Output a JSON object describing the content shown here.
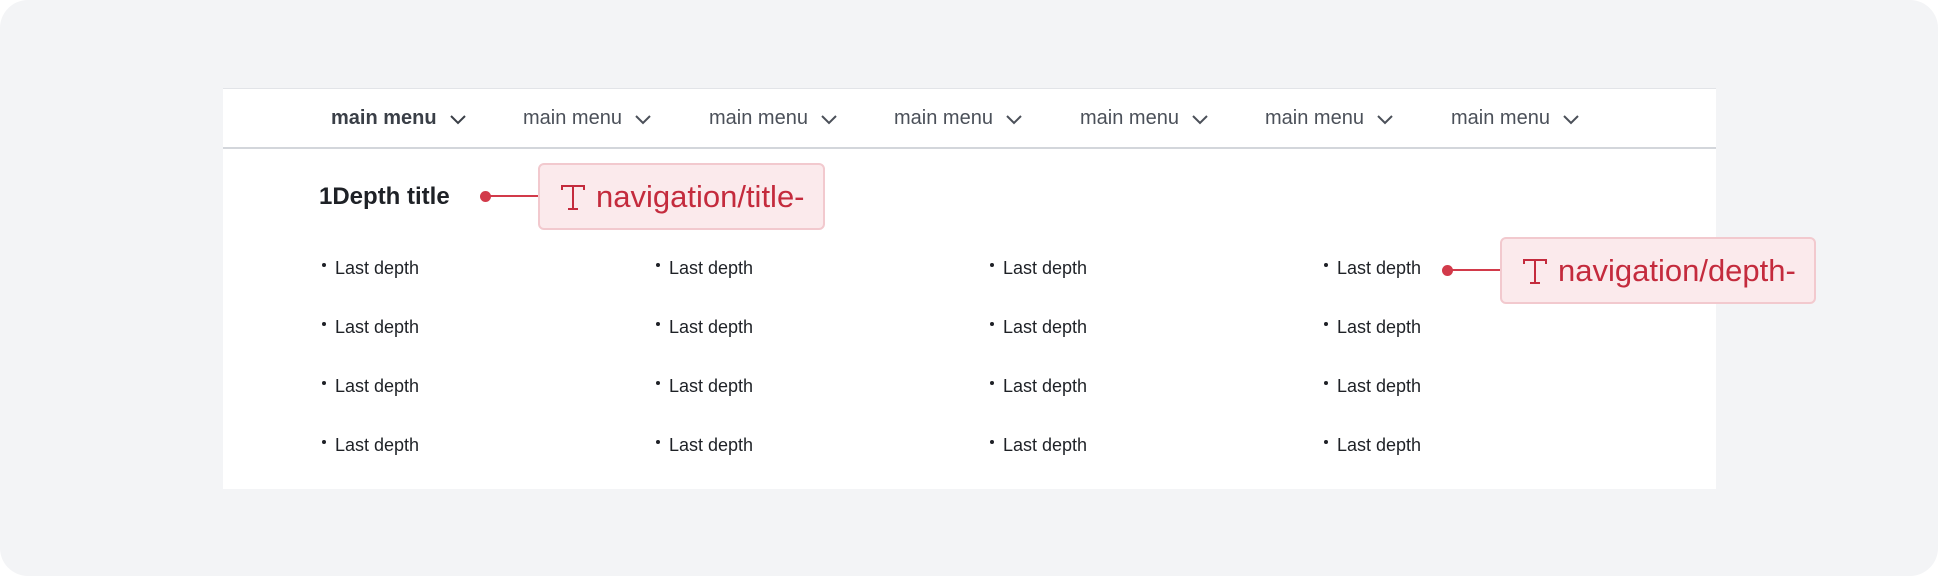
{
  "menu": {
    "items": [
      {
        "label": "main menu",
        "active": true
      },
      {
        "label": "main menu",
        "active": false
      },
      {
        "label": "main menu",
        "active": false
      },
      {
        "label": "main menu",
        "active": false
      },
      {
        "label": "main menu",
        "active": false
      },
      {
        "label": "main menu",
        "active": false
      },
      {
        "label": "main menu",
        "active": false
      }
    ],
    "chevron_icon": "chevron-down-icon"
  },
  "dropdown": {
    "title": "1Depth title",
    "columns": [
      [
        "Last depth",
        "Last depth",
        "Last depth",
        "Last depth"
      ],
      [
        "Last depth",
        "Last depth",
        "Last depth",
        "Last depth"
      ],
      [
        "Last depth",
        "Last depth",
        "Last depth",
        "Last depth"
      ],
      [
        "Last depth",
        "Last depth",
        "Last depth",
        "Last depth"
      ]
    ]
  },
  "annotations": {
    "title_tag": "navigation/title-",
    "depth_tag": "navigation/depth-",
    "icon": "text-type-icon",
    "color": "#d23a4a"
  },
  "colors": {
    "background": "#f3f4f6",
    "panel": "#ffffff",
    "text": "#1e2126",
    "accent": "#d23a4a"
  }
}
